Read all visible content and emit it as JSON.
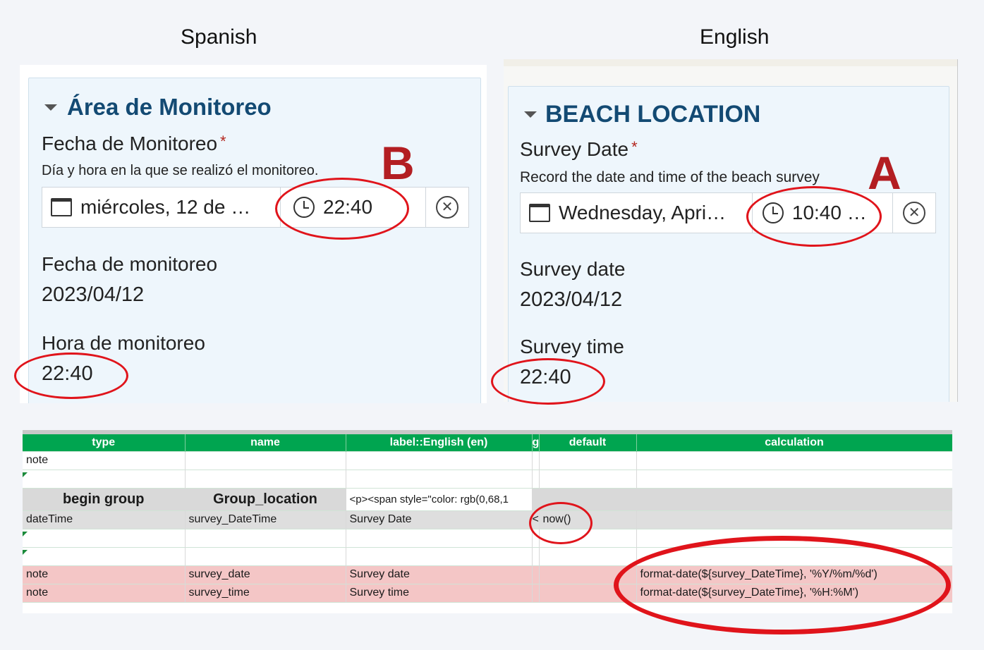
{
  "headings": {
    "left": "Spanish",
    "right": "English"
  },
  "spanish": {
    "group_title": "Área de Monitoreo",
    "question_label": "Fecha de Monitoreo",
    "required_mark": "*",
    "hint": "Día y hora en la que se realizó el monitoreo.",
    "date_value": "miércoles, 12 de …",
    "time_value": "22:40",
    "note1_label": "Fecha de monitoreo",
    "note1_value": "2023/04/12",
    "note2_label": "Hora de monitoreo",
    "note2_value": "22:40",
    "marker": "B"
  },
  "english": {
    "group_title": "BEACH LOCATION",
    "question_label": "Survey Date",
    "required_mark": "*",
    "hint": "Record the date and time of the beach survey",
    "date_value": "Wednesday, Apri…",
    "time_value": "10:40 …",
    "note1_label": "Survey date",
    "note1_value": "2023/04/12",
    "note2_label": "Survey time",
    "note2_value": "22:40",
    "marker": "A"
  },
  "icons": {
    "calendar": "calendar-icon",
    "clock": "clock-icon",
    "clear": "clear-icon",
    "collapse": "caret-down-icon"
  },
  "sheet": {
    "headers": [
      "type",
      "name",
      "label::English (en)",
      "g",
      "default",
      "calculation"
    ],
    "rows": [
      [
        "note",
        "",
        "",
        "",
        "",
        ""
      ],
      [
        "",
        "",
        "",
        "",
        "",
        ""
      ],
      [
        "begin group",
        "Group_location",
        "<p><span style=\"color: rgb(0,68,1",
        "",
        "",
        ""
      ],
      [
        "dateTime",
        "survey_DateTime",
        "Survey Date",
        "<",
        "now()",
        ""
      ],
      [
        "",
        "",
        "",
        "",
        "",
        ""
      ],
      [
        "",
        "",
        "",
        "",
        "",
        ""
      ],
      [
        "note",
        "survey_date",
        "Survey date",
        "",
        "",
        "format-date(${survey_DateTime}, '%Y/%m/%d')"
      ],
      [
        "note",
        "survey_time",
        "Survey time",
        "",
        "",
        "format-date(${survey_DateTime}, '%H:%M')"
      ]
    ]
  },
  "colors": {
    "header_green": "#00a550",
    "group_blue": "#134a73",
    "highlight_red": "#e0141b",
    "pink_row": "#f4c6c6"
  }
}
